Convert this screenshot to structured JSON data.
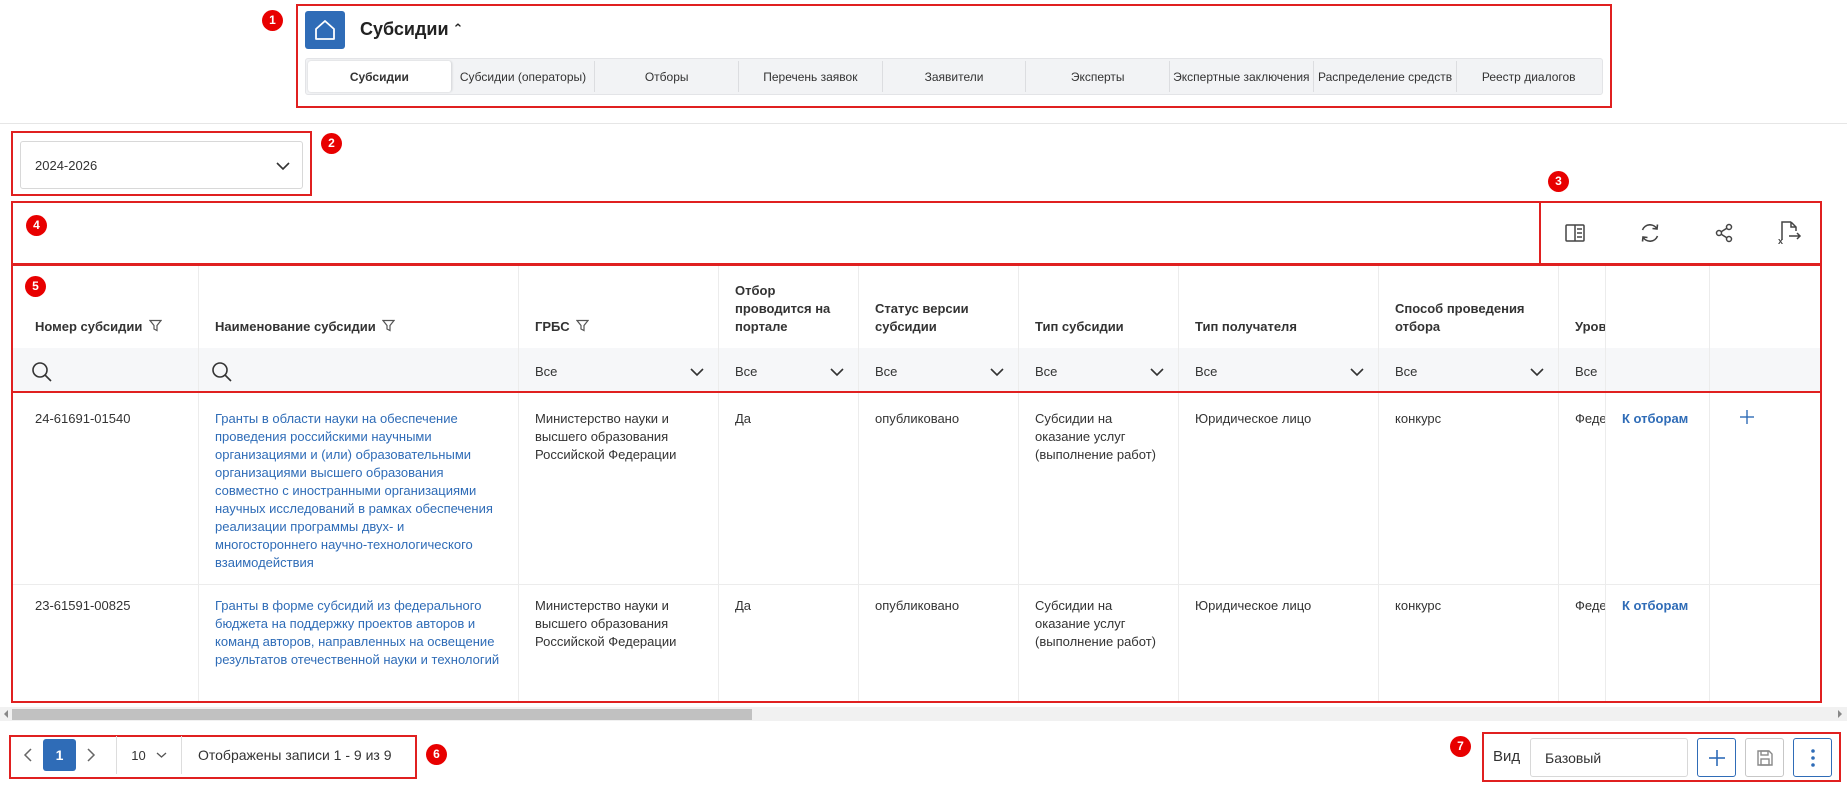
{
  "header": {
    "title": "Субсидии",
    "tabs": [
      "Субсидии",
      "Субсидии (операторы)",
      "Отборы",
      "Перечень заявок",
      "Заявители",
      "Эксперты",
      "Экспертные заключения",
      "Распределение средств",
      "Реестр диалогов"
    ]
  },
  "period": {
    "value": "2024-2026"
  },
  "markers": [
    "1",
    "2",
    "3",
    "4",
    "5",
    "6",
    "7"
  ],
  "table": {
    "headers": {
      "number": "Номер субсидии",
      "name": "Наименование субсидии",
      "grbs": "ГРБС",
      "portal": "Отбор проводится на портале",
      "status": "Статус версии субсидии",
      "type": "Тип субсидии",
      "recipient": "Тип получателя",
      "method": "Способ проведения отбора",
      "level": "Уров"
    },
    "filter_all": "Все",
    "rows": [
      {
        "number": "24-61691-01540",
        "name": "Гранты в области науки на обеспечение проведения российскими научными организациями и (или) образовательными организациями высшего образования совместно с иностранными организациями научных исследований в рамках обеспечения реализации программы двух- и многостороннего научно-технологического взаимодействия",
        "grbs": "Министерство науки и высшего образования Российской Федерации",
        "portal": "Да",
        "status": "опубликовано",
        "type": "Субсидии на оказание услуг (выполнение работ)",
        "recipient": "Юридическое лицо",
        "method": "конкурс",
        "level": "Феде",
        "action": "К отборам"
      },
      {
        "number": "23-61591-00825",
        "name": "Гранты в форме субсидий из федерального бюджета на поддержку проектов авторов и команд авторов, направленных на освещение результатов отечественной науки и технологий",
        "grbs": "Министерство науки и высшего образования Российской Федерации",
        "portal": "Да",
        "status": "опубликовано",
        "type": "Субсидии на оказание услуг (выполнение работ)",
        "recipient": "Юридическое лицо",
        "method": "конкурс",
        "level": "Феде",
        "action": "К отборам"
      }
    ]
  },
  "pagination": {
    "page": "1",
    "page_size": "10",
    "info": "Отображены записи 1 - 9 из 9"
  },
  "view": {
    "label": "Вид",
    "value": "Базовый"
  },
  "colors": {
    "accent": "#2f6cb7",
    "annotation": "#e02020"
  }
}
